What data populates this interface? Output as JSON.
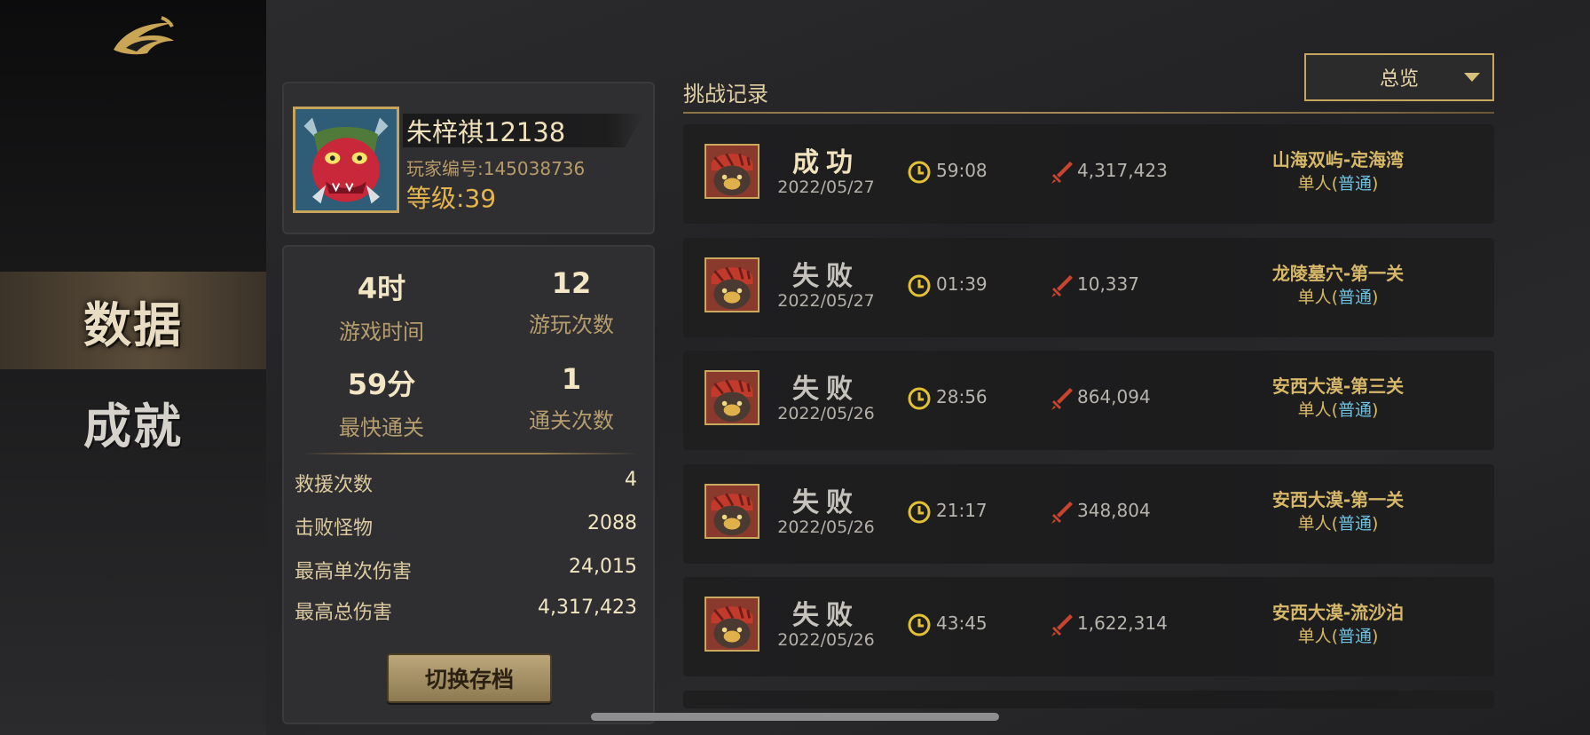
{
  "sidebar": {
    "nav": [
      {
        "label": "数据",
        "active": true
      },
      {
        "label": "成就",
        "active": false
      }
    ]
  },
  "profile": {
    "name": "朱梓祺12138",
    "player_id": "玩家编号:145038736",
    "level": "等级:39"
  },
  "stats": {
    "top": [
      {
        "value": "4时",
        "label": "游戏时间"
      },
      {
        "value": "12",
        "label": "游玩次数"
      },
      {
        "value": "59分",
        "label": "最快通关"
      },
      {
        "value": "1",
        "label": "通关次数"
      }
    ],
    "rows": [
      {
        "label": "救援次数",
        "value": "4"
      },
      {
        "label": "击败怪物",
        "value": "2088"
      },
      {
        "label": "最高单次伤害",
        "value": "24,015"
      },
      {
        "label": "最高总伤害",
        "value": "4,317,423"
      }
    ],
    "switch_button": "切换存档"
  },
  "records": {
    "title": "挑战记录",
    "filter": {
      "selected": "总览"
    },
    "items": [
      {
        "result": "成功",
        "outcome": "win",
        "date": "2022/05/27",
        "time": "59:08",
        "damage": "4,317,423",
        "stage": "山海双屿-定海湾",
        "mode_prefix": "单人(",
        "difficulty": "普通",
        "mode_suffix": ")"
      },
      {
        "result": "失败",
        "outcome": "lose",
        "date": "2022/05/27",
        "time": "01:39",
        "damage": "10,337",
        "stage": "龙陵墓穴-第一关",
        "mode_prefix": "单人(",
        "difficulty": "普通",
        "mode_suffix": ")"
      },
      {
        "result": "失败",
        "outcome": "lose",
        "date": "2022/05/26",
        "time": "28:56",
        "damage": "864,094",
        "stage": "安西大漠-第三关",
        "mode_prefix": "单人(",
        "difficulty": "普通",
        "mode_suffix": ")"
      },
      {
        "result": "失败",
        "outcome": "lose",
        "date": "2022/05/26",
        "time": "21:17",
        "damage": "348,804",
        "stage": "安西大漠-第一关",
        "mode_prefix": "单人(",
        "difficulty": "普通",
        "mode_suffix": ")"
      },
      {
        "result": "失败",
        "outcome": "lose",
        "date": "2022/05/26",
        "time": "43:45",
        "damage": "1,622,314",
        "stage": "安西大漠-流沙泊",
        "mode_prefix": "单人(",
        "difficulty": "普通",
        "mode_suffix": ")"
      }
    ]
  },
  "colors": {
    "gold_accent": "#c6a75f",
    "stage_text": "#d6b868",
    "difficulty_text": "#6ec0de",
    "clock_icon": "#e2c234",
    "sword_icon": "#c8442e"
  }
}
